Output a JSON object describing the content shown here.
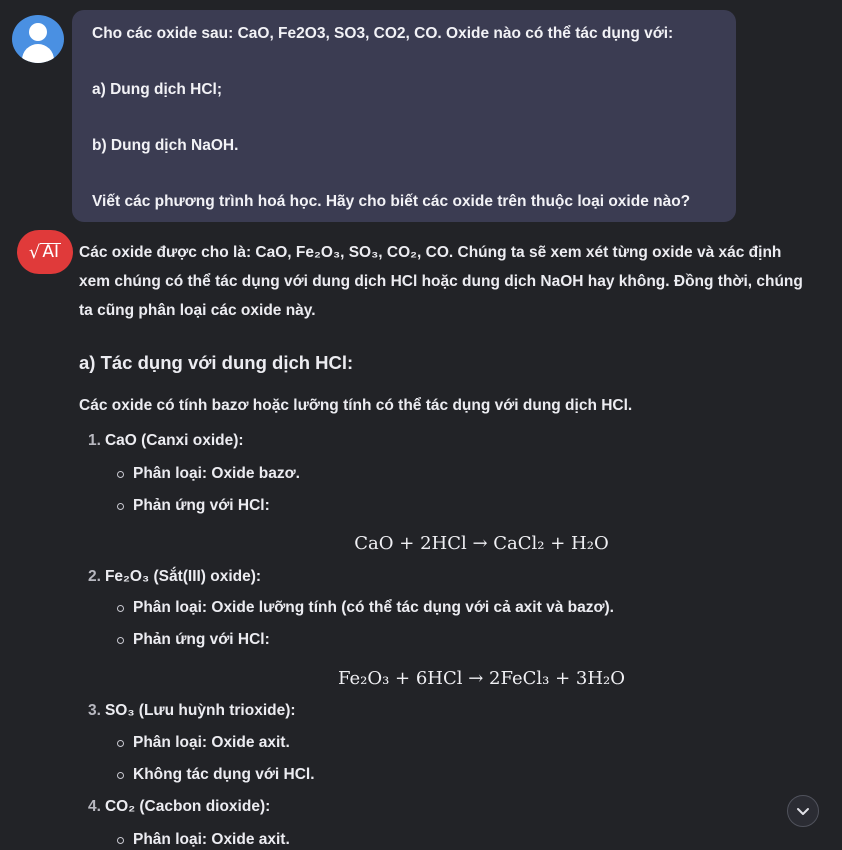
{
  "user_message": {
    "question": "Cho các oxide sau: CaO, Fe2O3, SO3, CO2, CO. Oxide nào có thể tác dụng với:",
    "part_a": "a) Dung dịch HCl;",
    "part_b": "b) Dung dịch NaOH.",
    "instruction": "Viết các phương trình hoá học. Hãy cho biết các oxide trên thuộc loại oxide nào?"
  },
  "assistant": {
    "avatar_label": "AI",
    "intro_line1": "Các oxide được cho là: CaO, Fe₂O₃, SO₃, CO₂, CO. Chúng ta sẽ xem xét từng oxide và xác định",
    "intro_line2": "xem chúng có thể tác dụng với dung dịch HCl hoặc dung dịch NaOH hay không. Đồng thời, chúng",
    "intro_line3": "ta cũng phân loại các oxide này.",
    "section_a_title": "a) Tác dụng với dung dịch HCl:",
    "section_a_lead": "Các oxide có tính bazơ hoặc lưỡng tính có thể tác dụng với dung dịch HCl.",
    "items": [
      {
        "number": "1.",
        "name": "CaO (Canxi oxide):",
        "class_label": "Phân loại:",
        "class_value": " Oxide bazơ.",
        "reaction_label": "Phản ứng với HCl:",
        "equation": "CaO + 2HCl → CaCl₂ + H₂O"
      },
      {
        "number": "2.",
        "name": "Fe₂O₃ (Sắt(III) oxide):",
        "class_label": "Phân loại:",
        "class_value": " Oxide lưỡng tính (có thể tác dụng với cả axit và bazơ).",
        "reaction_label": "Phản ứng với HCl:",
        "equation": "Fe₂O₃ + 6HCl → 2FeCl₃ + 3H₂O"
      },
      {
        "number": "3.",
        "name": "SO₃ (Lưu huỳnh trioxide):",
        "class_label": "Phân loại:",
        "class_value": " Oxide axit.",
        "note": "Không tác dụng với HCl."
      },
      {
        "number": "4.",
        "name": "CO₂ (Cacbon dioxide):",
        "class_label": "Phân loại:",
        "class_value": " Oxide axit."
      }
    ]
  },
  "icons": {
    "user_avatar": "user-icon",
    "assistant_avatar": "sqrt-ai-logo",
    "scroll_down": "chevron-down-icon"
  },
  "colors": {
    "background": "#222327",
    "user_bubble": "#3b3c52",
    "user_avatar": "#4a90e2",
    "assistant_avatar": "#e03a3a"
  }
}
